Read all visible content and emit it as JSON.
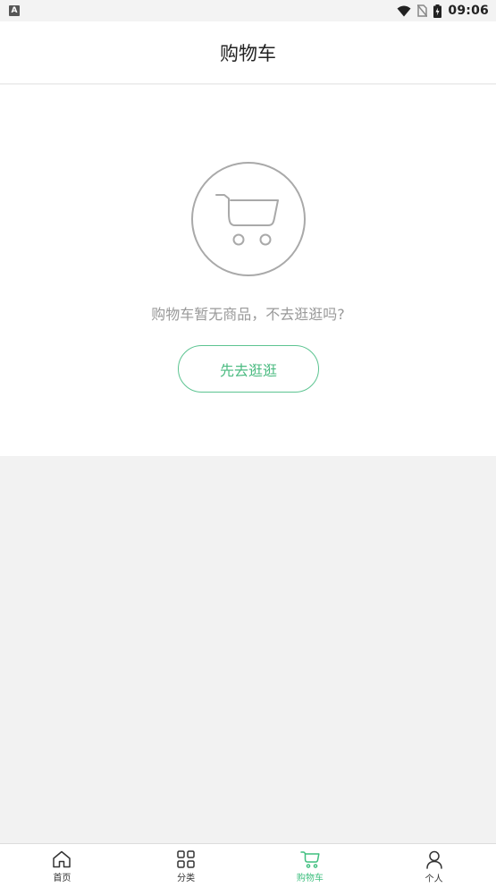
{
  "status_bar": {
    "left_badge": "A",
    "time": "09:06",
    "icons": [
      "wifi-icon",
      "no-sim-icon",
      "battery-icon"
    ]
  },
  "header": {
    "title": "购物车"
  },
  "empty_state": {
    "icon": "shopping-cart-icon",
    "message": "购物车暂无商品，不去逛逛吗?",
    "button_label": "先去逛逛"
  },
  "bottom_nav": {
    "items": [
      {
        "label": "首页",
        "icon": "home-icon",
        "active": false
      },
      {
        "label": "分类",
        "icon": "grid-icon",
        "active": false
      },
      {
        "label": "购物车",
        "icon": "cart-icon",
        "active": true
      },
      {
        "label": "个人",
        "icon": "user-icon",
        "active": false
      }
    ]
  },
  "colors": {
    "accent": "#4cbb82",
    "background": "#f2f2f2",
    "card": "#ffffff",
    "muted_text": "#999999"
  }
}
